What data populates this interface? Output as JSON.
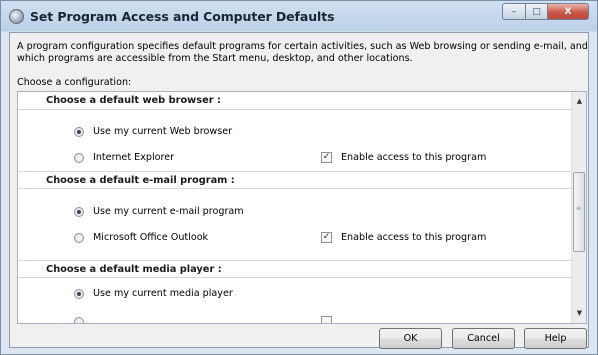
{
  "window": {
    "title": "Set Program Access and Computer Defaults",
    "caption_minimize": "–",
    "caption_maximize": "□",
    "caption_close": "X"
  },
  "description": "A program configuration specifies default programs for certain activities, such as Web browsing or sending e-mail, and which programs are accessible from the Start menu, desktop, and other locations.",
  "choose_label": "Choose a configuration:",
  "sections": [
    {
      "header": "Choose a default web browser :",
      "current_label": "Use my current Web browser",
      "current_selected": true,
      "program_label": "Internet Explorer",
      "program_selected": false,
      "enable_label": "Enable access to this program",
      "enable_checked": true
    },
    {
      "header": "Choose a default e-mail program :",
      "current_label": "Use my current e-mail program",
      "current_selected": true,
      "program_label": "Microsoft Office Outlook",
      "program_selected": false,
      "enable_label": "Enable access to this program",
      "enable_checked": true
    },
    {
      "header": "Choose a default media player :",
      "current_label": "Use my current media player",
      "current_selected": true
    }
  ],
  "scrollbar": {
    "up_arrow": "▲",
    "down_arrow": "▼",
    "grip": "≡"
  },
  "buttons": {
    "ok": "OK",
    "cancel": "Cancel",
    "help": "Help"
  },
  "check_glyph": "✓"
}
